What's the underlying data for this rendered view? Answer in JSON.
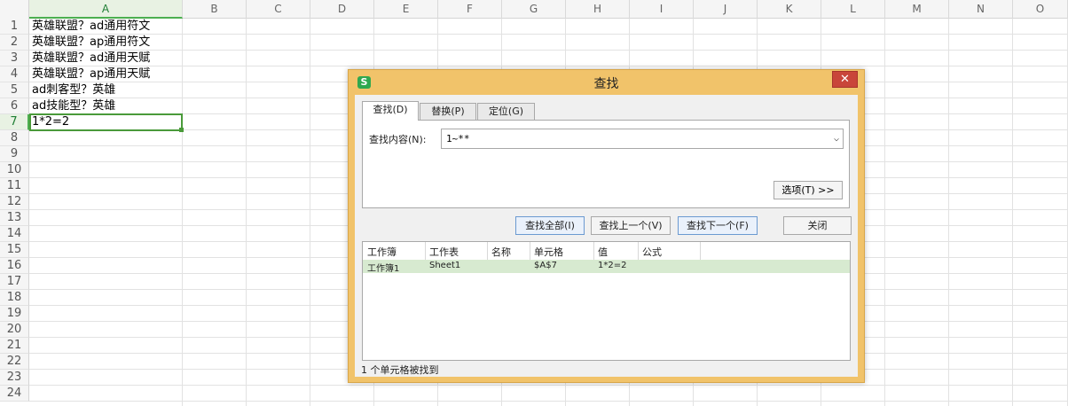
{
  "sheet": {
    "columns": [
      "A",
      "B",
      "C",
      "D",
      "E",
      "F",
      "G",
      "H",
      "I",
      "J",
      "K",
      "L",
      "M",
      "N",
      "O"
    ],
    "rows": [
      "1",
      "2",
      "3",
      "4",
      "5",
      "6",
      "7",
      "8",
      "9",
      "10",
      "11",
      "12",
      "13",
      "14",
      "15",
      "16",
      "17",
      "18",
      "19",
      "20",
      "21",
      "22",
      "23",
      "24"
    ],
    "active_column": "A",
    "active_row": "7",
    "cells": [
      "英雄联盟？ad通用符文",
      "英雄联盟？ap通用符文",
      "英雄联盟？ad通用天赋",
      "英雄联盟？ap通用天赋",
      "ad刺客型？英雄",
      "ad技能型？英雄",
      "1*2=2"
    ],
    "accent_color": "#4a9a3a"
  },
  "dialog": {
    "app_icon": "S",
    "title": "查找",
    "close_label": "✕",
    "tabs": [
      "查找(D)",
      "替换(P)",
      "定位(G)"
    ],
    "find_label": "查找内容(N):",
    "find_value": "1~**",
    "options_label": "选项(T) >>",
    "buttons": {
      "find_all": "查找全部(I)",
      "find_prev": "查找上一个(V)",
      "find_next": "查找下一个(F)",
      "close": "关闭"
    },
    "results": {
      "headers": [
        "工作簿",
        "工作表",
        "名称",
        "单元格",
        "值",
        "公式"
      ],
      "rows": [
        [
          "工作簿1",
          "Sheet1",
          "",
          "$A$7",
          "1*2=2",
          ""
        ]
      ]
    },
    "status": "1 个单元格被找到",
    "title_bar_color": "#f1c36a",
    "close_color": "#c9453a",
    "highlight_row_color": "#d7ead0"
  }
}
